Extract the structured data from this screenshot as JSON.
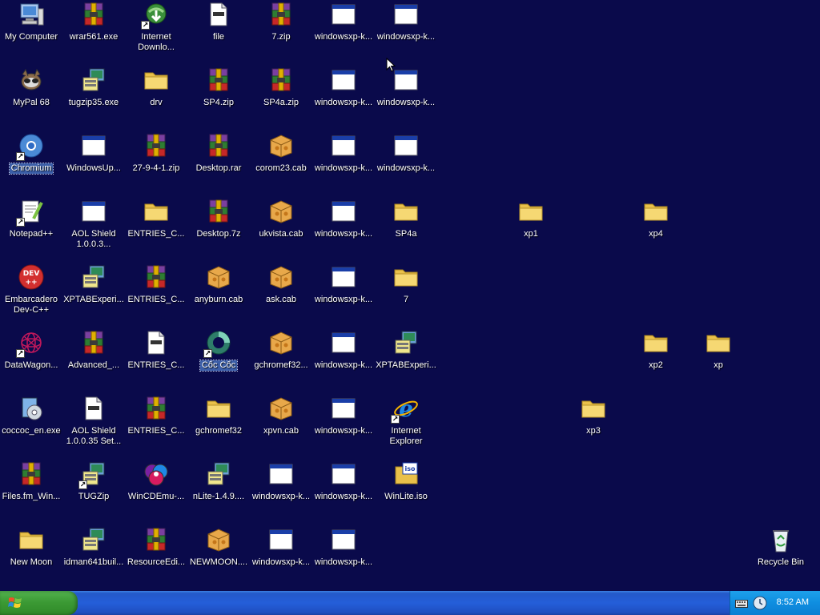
{
  "desktop": {
    "icons": [
      {
        "label": "My Computer",
        "type": "computer"
      },
      {
        "label": "wrar561.exe",
        "type": "archive"
      },
      {
        "label": "Internet Downlo...",
        "type": "idm",
        "shortcut": true
      },
      {
        "label": "file",
        "type": "text"
      },
      {
        "label": "7.zip",
        "type": "archive"
      },
      {
        "label": "windowsxp-k...",
        "type": "window"
      },
      {
        "label": "windowsxp-k...",
        "type": "window"
      },
      {
        "label": "MyPal 68",
        "type": "mypal"
      },
      {
        "label": "tugzip35.exe",
        "type": "installer"
      },
      {
        "label": "drv",
        "type": "folder"
      },
      {
        "label": "SP4.zip",
        "type": "archive"
      },
      {
        "label": "SP4a.zip",
        "type": "archive"
      },
      {
        "label": "windowsxp-k...",
        "type": "window"
      },
      {
        "label": "windowsxp-k...",
        "type": "window"
      },
      {
        "label": "Chromium",
        "type": "chromium",
        "shortcut": true,
        "selected": true
      },
      {
        "label": "WindowsUp...",
        "type": "window"
      },
      {
        "label": "27-9-4-1.zip",
        "type": "archive"
      },
      {
        "label": "Desktop.rar",
        "type": "archive"
      },
      {
        "label": "corom23.cab",
        "type": "cab"
      },
      {
        "label": "windowsxp-k...",
        "type": "window"
      },
      {
        "label": "windowsxp-k...",
        "type": "window"
      },
      {
        "label": "Notepad++",
        "type": "notepad",
        "shortcut": true
      },
      {
        "label": "AOL Shield 1.0.0.3...",
        "type": "window"
      },
      {
        "label": "ENTRIES_C...",
        "type": "folder"
      },
      {
        "label": "Desktop.7z",
        "type": "archive"
      },
      {
        "label": "ukvista.cab",
        "type": "cab"
      },
      {
        "label": "windowsxp-k...",
        "type": "window"
      },
      {
        "label": "SP4a",
        "type": "folder"
      },
      {
        "label": "xp1",
        "type": "folder"
      },
      {
        "label": "xp4",
        "type": "folder"
      },
      {
        "label": "Embarcadero Dev-C++",
        "type": "devcpp"
      },
      {
        "label": "XPTABExperi...",
        "type": "installer"
      },
      {
        "label": "ENTRIES_C...",
        "type": "archive"
      },
      {
        "label": "anyburn.cab",
        "type": "cab"
      },
      {
        "label": "ask.cab",
        "type": "cab"
      },
      {
        "label": "windowsxp-k...",
        "type": "window"
      },
      {
        "label": "7",
        "type": "folder"
      },
      {
        "label": "DataWagon...",
        "type": "datawagon",
        "shortcut": true
      },
      {
        "label": "Advanced_...",
        "type": "archive"
      },
      {
        "label": "ENTRIES_C...",
        "type": "text"
      },
      {
        "label": "Cốc Cốc",
        "type": "coccoc",
        "shortcut": true,
        "selected": true
      },
      {
        "label": "gchromef32...",
        "type": "cab"
      },
      {
        "label": "windowsxp-k...",
        "type": "window"
      },
      {
        "label": "XPTABExperi...",
        "type": "installer"
      },
      {
        "label": "xp2",
        "type": "folder"
      },
      {
        "label": "xp",
        "type": "folder"
      },
      {
        "label": "coccoc_en.exe",
        "type": "setup"
      },
      {
        "label": "AOL Shield 1.0.0.35 Set...",
        "type": "text"
      },
      {
        "label": "ENTRIES_C...",
        "type": "archive"
      },
      {
        "label": "gchromef32",
        "type": "folder"
      },
      {
        "label": "xpvn.cab",
        "type": "cab"
      },
      {
        "label": "windowsxp-k...",
        "type": "window"
      },
      {
        "label": "Internet Explorer",
        "type": "ie",
        "shortcut": true
      },
      {
        "label": "xp3",
        "type": "folder"
      },
      {
        "label": "Files.fm_Win...",
        "type": "archive"
      },
      {
        "label": "TUGZip",
        "type": "installer",
        "shortcut": true
      },
      {
        "label": "WinCDEmu-...",
        "type": "disc"
      },
      {
        "label": "nLite-1.4.9....",
        "type": "installer"
      },
      {
        "label": "windowsxp-k...",
        "type": "window"
      },
      {
        "label": "windowsxp-k...",
        "type": "window"
      },
      {
        "label": "WinLite.iso",
        "type": "iso"
      },
      {
        "label": "New Moon",
        "type": "folder"
      },
      {
        "label": "idman641buil...",
        "type": "installer"
      },
      {
        "label": "ResourceEdi...",
        "type": "archive"
      },
      {
        "label": "NEWMOON....",
        "type": "cab"
      },
      {
        "label": "windowsxp-k...",
        "type": "window"
      },
      {
        "label": "windowsxp-k...",
        "type": "window"
      },
      {
        "label": "Recycle Bin",
        "type": "recycle"
      }
    ]
  },
  "taskbar": {
    "clock": "8:52 AM"
  },
  "colors": {
    "desktop_bg": "#0a0a4b",
    "taskbar": "#245ed9",
    "start_button": "#3c9a35",
    "tray": "#0f8ee0"
  }
}
